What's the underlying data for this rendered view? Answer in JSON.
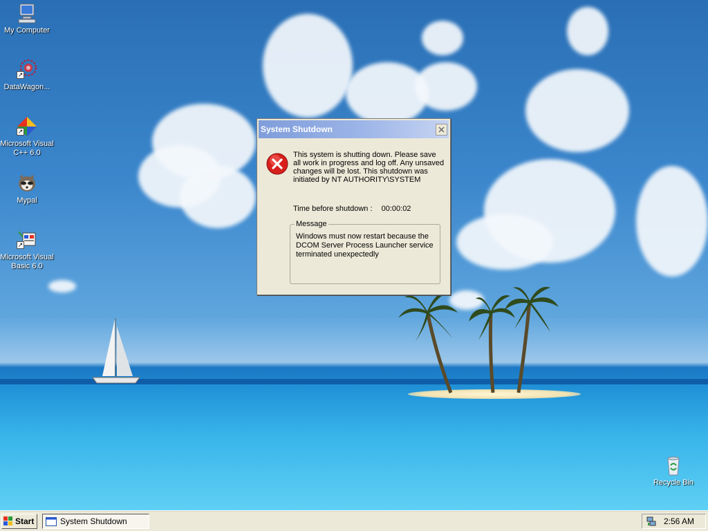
{
  "desktop": {
    "icons": [
      {
        "label": "My Computer",
        "icon": "computer-icon"
      },
      {
        "label": "DataWagon...",
        "icon": "datawagon-icon"
      },
      {
        "label": "Microsoft Visual C++ 6.0",
        "icon": "visual-cpp-icon"
      },
      {
        "label": "Mypal",
        "icon": "mypal-icon"
      },
      {
        "label": "Microsoft Visual Basic 6.0",
        "icon": "visual-basic-icon"
      },
      {
        "label": "Recycle Bin",
        "icon": "recycle-bin-icon"
      }
    ]
  },
  "dialog": {
    "title": "System Shutdown",
    "message": "This system is shutting down. Please save all work in progress and log off. Any unsaved changes will be lost. This shutdown was initiated by NT AUTHORITY\\SYSTEM",
    "countdown_label": "Time before shutdown :",
    "countdown_value": "00:00:02",
    "group_label": "Message",
    "group_text": "Windows must now restart because the DCOM Server Process Launcher service terminated unexpectedly",
    "icon": "error-icon"
  },
  "taskbar": {
    "start_label": "Start",
    "task_label": "System Shutdown",
    "clock": "2:56 AM"
  },
  "colors": {
    "title_gradient_start": "#7f9ddb",
    "dialog_face": "#ece9d8",
    "error_red": "#d8201c"
  }
}
